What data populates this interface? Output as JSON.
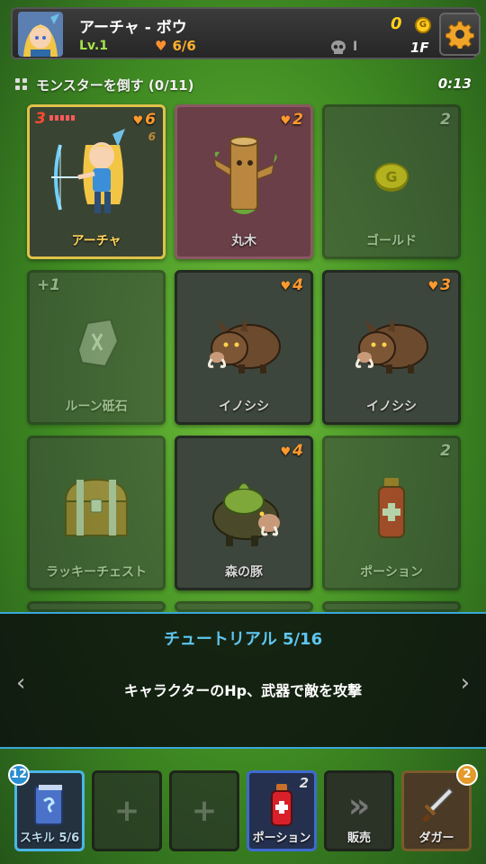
{
  "hud": {
    "name": "アーチャ - ボウ",
    "level": "Lv.1",
    "hp": "6/6",
    "gold": "0",
    "gold_symbol": "G",
    "kills": "I",
    "floor": "1F",
    "portrait_icon": "archer-portrait-icon",
    "settings_icon": "gear-icon"
  },
  "quest": {
    "text": "モンスターを倒す (0/11)",
    "timer": "0:13"
  },
  "cards": [
    {
      "label": "アーチャ",
      "atk": "3",
      "hp": "6",
      "armor": "6",
      "icon": "archer-hero-icon"
    },
    {
      "label": "丸木",
      "hp": "2",
      "icon": "log-icon"
    },
    {
      "label": "ゴールド",
      "value": "2",
      "icon": "gold-coin-icon"
    },
    {
      "label": "ルーン砥石",
      "value": "+1",
      "icon": "rune-stone-icon"
    },
    {
      "label": "イノシシ",
      "hp": "4",
      "icon": "boar-icon"
    },
    {
      "label": "イノシシ",
      "hp": "3",
      "icon": "boar-icon"
    },
    {
      "label": "ラッキーチェスト",
      "icon": "treasure-chest-icon"
    },
    {
      "label": "森の豚",
      "hp": "4",
      "icon": "forest-pig-icon"
    },
    {
      "label": "ポーション",
      "value": "2",
      "icon": "potion-icon"
    }
  ],
  "tutorial": {
    "title": "チュートリアル 5/16",
    "message": "キャラクターのHp、武器で敵を攻撃",
    "prev": "‹",
    "next": "›"
  },
  "bottom": {
    "skill": {
      "label": "スキル 5/6",
      "badge": "12",
      "icon": "skill-book-icon"
    },
    "empty_plus": "+",
    "potion": {
      "label": "ポーション",
      "count": "2",
      "icon": "potion-icon"
    },
    "sell": {
      "label": "販売",
      "glyph": "»",
      "icon": "sell-arrows-icon"
    },
    "dagger": {
      "label": "ダガー",
      "badge": "2",
      "icon": "dagger-icon"
    }
  },
  "colors": {
    "accent_blue": "#3aa7d8",
    "gold": "#ffd21c",
    "hp_orange": "#ff9a2e",
    "level_green": "#a6e34a"
  }
}
